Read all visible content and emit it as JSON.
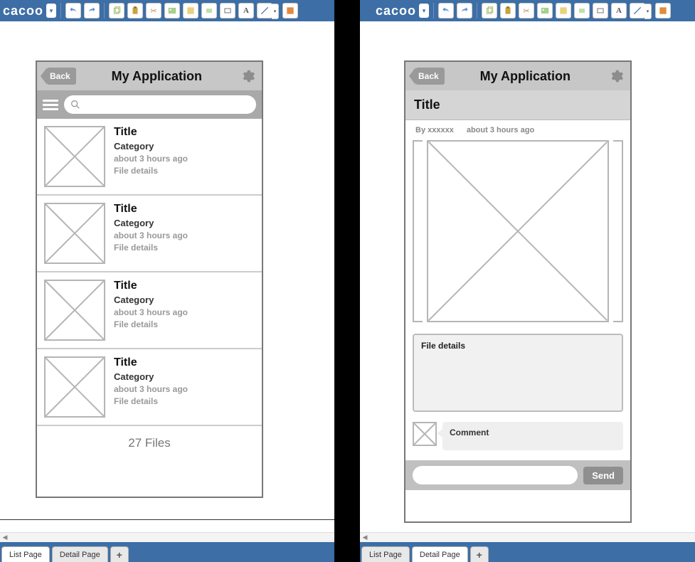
{
  "app": {
    "logo": "cacoo"
  },
  "sheets": {
    "left_active": "List Page",
    "right_active": "Detail Page",
    "tabs": [
      "List Page",
      "Detail Page"
    ]
  },
  "toolbar_icons": [
    "undo",
    "redo",
    "copy",
    "paste",
    "cut",
    "shape-green",
    "shape-yellow",
    "rect",
    "rect-outline",
    "text",
    "line",
    "arrow-dd",
    "fill"
  ],
  "list_page": {
    "back": "Back",
    "title": "My Application",
    "search_placeholder": "",
    "items": [
      {
        "title": "Title",
        "category": "Category",
        "time": "about 3 hours ago",
        "details": "File details"
      },
      {
        "title": "Title",
        "category": "Category",
        "time": "about 3 hours ago",
        "details": "File details"
      },
      {
        "title": "Title",
        "category": "Category",
        "time": "about 3 hours ago",
        "details": "File details"
      },
      {
        "title": "Title",
        "category": "Category",
        "time": "about 3 hours ago",
        "details": "File details"
      }
    ],
    "footer": "27 Files"
  },
  "detail_page": {
    "back": "Back",
    "title": "My Application",
    "content_title": "Title",
    "byline_author": "By xxxxxx",
    "byline_time": "about 3 hours ago",
    "filebox": "File details",
    "comment": "Comment",
    "send": "Send"
  }
}
